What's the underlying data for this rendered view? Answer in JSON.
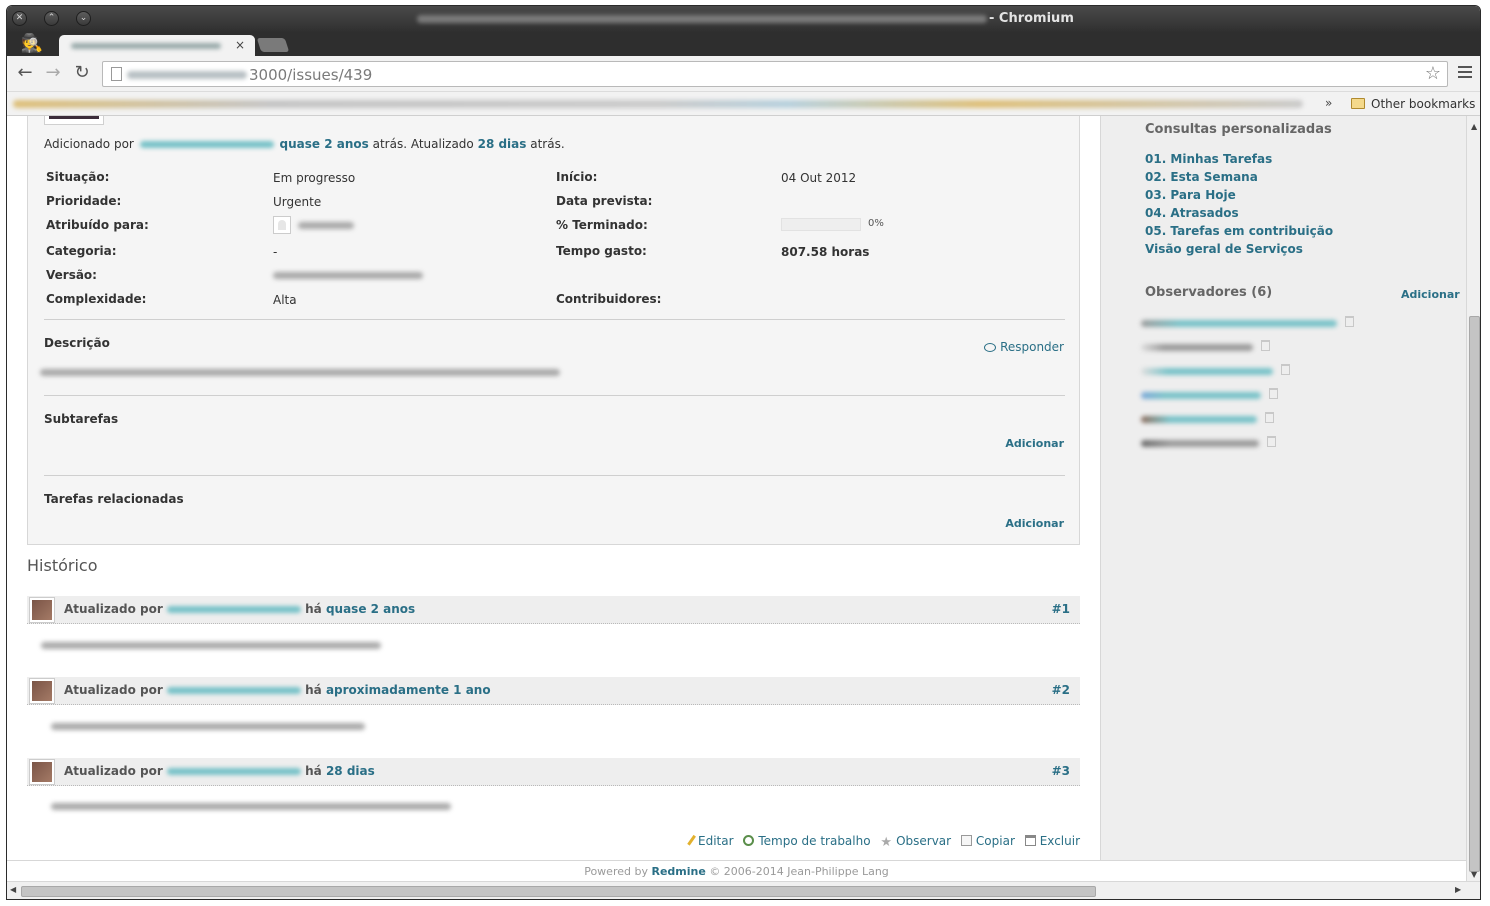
{
  "browser": {
    "title_suffix": "- Chromium",
    "tab_close": "×",
    "url_visible": "3000/issues/439",
    "other_bookmarks": "Other bookmarks",
    "bookmarks_chevron": "»"
  },
  "issue": {
    "added_prefix": "Adicionado por",
    "added_ago": "quase 2 anos",
    "added_mid": "atrás. Atualizado",
    "updated_ago": "28 dias",
    "updated_suffix": "atrás.",
    "attributes": {
      "status_label": "Situação:",
      "status_value": "Em progresso",
      "priority_label": "Prioridade:",
      "priority_value": "Urgente",
      "assigned_label": "Atribuído para:",
      "category_label": "Categoria:",
      "category_value": "-",
      "version_label": "Versão:",
      "complexity_label": "Complexidade:",
      "complexity_value": "Alta",
      "start_label": "Início:",
      "start_value": "04 Out 2012",
      "due_label": "Data prevista:",
      "done_label": "% Terminado:",
      "done_value": "0%",
      "done_ratio": 0,
      "spent_label": "Tempo gasto:",
      "spent_value": "807.58 horas",
      "contributors_label": "Contribuidores:"
    },
    "description_title": "Descrição",
    "reply": "Responder",
    "subtasks_title": "Subtarefas",
    "subtasks_add": "Adicionar",
    "relations_title": "Tarefas relacionadas",
    "relations_add": "Adicionar"
  },
  "history": {
    "title": "Histórico",
    "entries": [
      {
        "prefix": "Atualizado por",
        "ha": "há",
        "when": "quase 2 anos",
        "num": "#1"
      },
      {
        "prefix": "Atualizado por",
        "ha": "há",
        "when": "aproximadamente 1 ano",
        "num": "#2"
      },
      {
        "prefix": "Atualizado por",
        "ha": "há",
        "when": "28 dias",
        "num": "#3"
      }
    ]
  },
  "actions": {
    "edit": "Editar",
    "time": "Tempo de trabalho",
    "watch": "Observar",
    "copy": "Copiar",
    "delete": "Excluir"
  },
  "footer": {
    "powered_by": "Powered by",
    "redmine": "Redmine",
    "copyright": "© 2006-2014 Jean-Philippe Lang"
  },
  "sidebar": {
    "queries_title": "Consultas personalizadas",
    "queries": [
      "01. Minhas Tarefas",
      "02. Esta Semana",
      "03. Para Hoje",
      "04. Atrasados",
      "05. Tarefas em contribuição",
      "Visão geral de Serviços"
    ],
    "watchers_title": "Observadores (6)",
    "watchers_add": "Adicionar"
  },
  "colors": {
    "link": "#2a6f86",
    "sidebar_bg": "#eeeeee"
  }
}
